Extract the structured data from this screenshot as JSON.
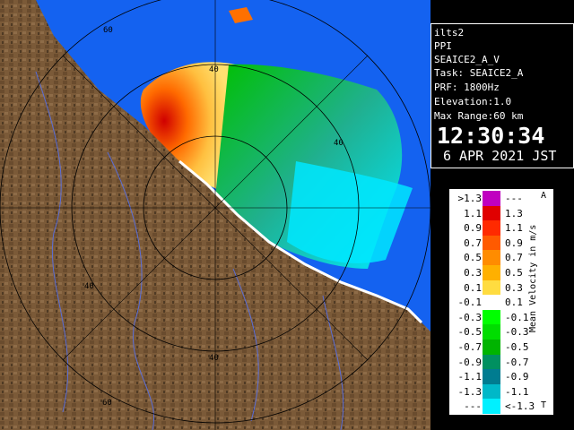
{
  "info": {
    "site": "ilts2",
    "product": "PPI",
    "task_name": "SEAICE2_A_V",
    "task": "Task: SEAICE2_A",
    "prf": "PRF: 1800Hz",
    "elevation": "Elevation:1.0",
    "max_range": "Max Range:60 km",
    "time": "12:30:34",
    "date": "6 APR 2021 JST"
  },
  "rings": {
    "labels": [
      "60",
      "40",
      "40",
      "40",
      "60",
      "40"
    ]
  },
  "legend": {
    "title": "Mean Velocity in m/s",
    "corner_top": "A",
    "corner_bottom": "T",
    "rows": [
      {
        "lo": ">1.3",
        "hi": "---",
        "color": "#c000c0"
      },
      {
        "lo": "1.1",
        "hi": "1.3",
        "color": "#e00000"
      },
      {
        "lo": "0.9",
        "hi": "1.1",
        "color": "#ff2a00"
      },
      {
        "lo": "0.7",
        "hi": "0.9",
        "color": "#ff5a00"
      },
      {
        "lo": "0.5",
        "hi": "0.7",
        "color": "#ff8c00"
      },
      {
        "lo": "0.3",
        "hi": "0.5",
        "color": "#ffb000"
      },
      {
        "lo": "0.1",
        "hi": "0.3",
        "color": "#ffdc40"
      },
      {
        "lo": "-0.1",
        "hi": "0.1",
        "color": "#ffffff"
      },
      {
        "lo": "-0.3",
        "hi": "-0.1",
        "color": "#00ff00"
      },
      {
        "lo": "-0.5",
        "hi": "-0.3",
        "color": "#00dd00"
      },
      {
        "lo": "-0.7",
        "hi": "-0.5",
        "color": "#00b400"
      },
      {
        "lo": "-0.9",
        "hi": "-0.7",
        "color": "#009060"
      },
      {
        "lo": "-1.1",
        "hi": "-0.9",
        "color": "#007c90"
      },
      {
        "lo": "-1.3",
        "hi": "-1.1",
        "color": "#00b8c8"
      },
      {
        "lo": "---",
        "hi": "<-1.3",
        "color": "#00f0ff"
      }
    ]
  },
  "colors": {
    "sea": "#1462f0",
    "land": "#7b5a38",
    "land_dark": "#4d3a25",
    "ring": "#000000"
  }
}
